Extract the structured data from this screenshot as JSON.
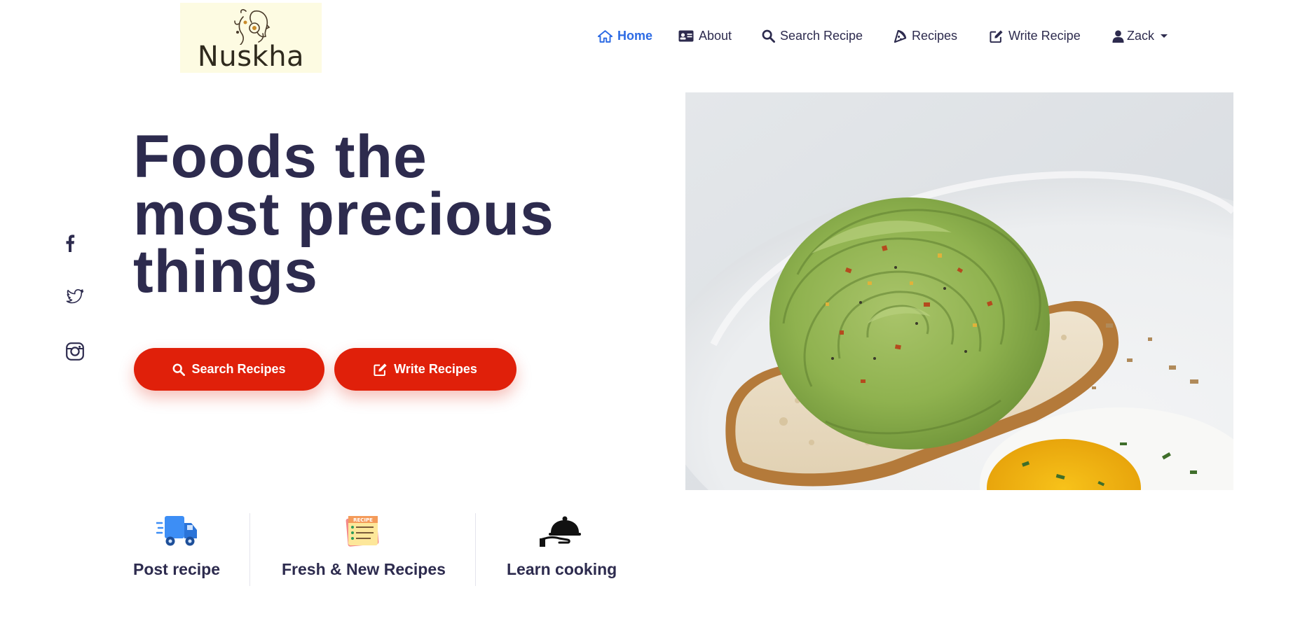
{
  "brand": {
    "logo_text": "Nuskha"
  },
  "nav": {
    "items": [
      {
        "label": "Home",
        "icon": "home-icon",
        "active": true
      },
      {
        "label": "About",
        "icon": "id-card-icon"
      },
      {
        "label": "Search Recipe",
        "icon": "search-icon"
      },
      {
        "label": "Recipes",
        "icon": "pizza-icon"
      },
      {
        "label": "Write Recipe",
        "icon": "edit-icon"
      }
    ],
    "user": {
      "label": "Zack",
      "icon": "user-icon"
    }
  },
  "social": [
    "facebook-icon",
    "twitter-icon",
    "instagram-icon"
  ],
  "hero": {
    "title_lines": [
      "Foods the",
      "most precious",
      "things"
    ],
    "buttons": [
      {
        "label": "Search Recipes",
        "icon": "search-icon"
      },
      {
        "label": "Write Recipes",
        "icon": "edit-icon"
      }
    ],
    "image": "avocado-rose-toast-photo"
  },
  "features": [
    {
      "label": "Post recipe",
      "icon": "delivery-truck-icon"
    },
    {
      "label": "Fresh & New Recipes",
      "icon": "recipe-card-icon"
    },
    {
      "label": "Learn cooking",
      "icon": "cloche-icon"
    }
  ],
  "colors": {
    "primary_text": "#2d2b4e",
    "active_link": "#2d6be4",
    "button": "#e0200a",
    "logo_bg": "#fdfbe2"
  }
}
